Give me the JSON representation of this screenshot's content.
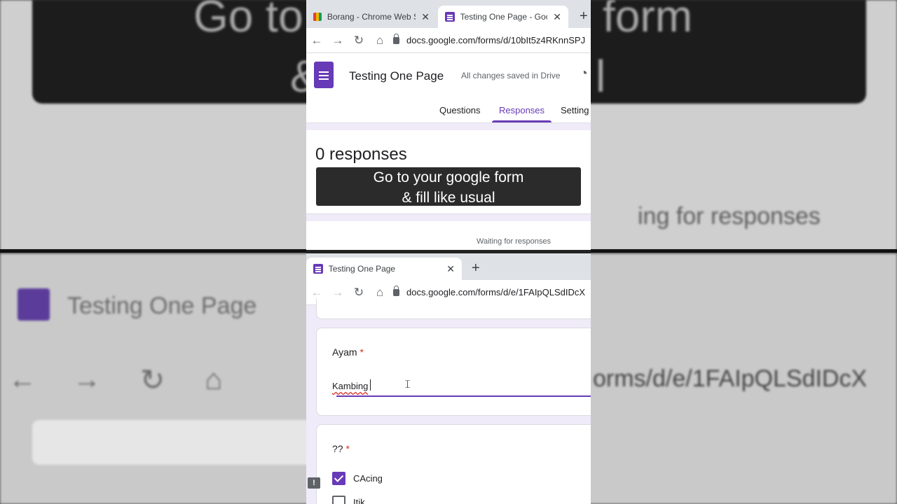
{
  "background": {
    "top_left_text": "Go to",
    "top_right_text": "form",
    "top_left2": "&",
    "top_right2": "l",
    "right_waiting": "ing for responses",
    "left_title": "Testing One Page",
    "right_url": "orms/d/e/1FAIpQLSdIDcX"
  },
  "top_window": {
    "tabs": [
      {
        "label": "Borang - Chrome Web Sto",
        "close": "✕"
      },
      {
        "label": "Testing One Page - Googl",
        "close": "✕"
      }
    ],
    "new_tab": "+",
    "url": "docs.google.com/forms/d/10bIt5z4RKnnSPJ",
    "form_title": "Testing One Page",
    "save_status": "All changes saved in Drive",
    "nav_tabs": [
      "Questions",
      "Responses",
      "Setting"
    ],
    "responses_count": "0 responses",
    "waiting": "Waiting for responses"
  },
  "caption": {
    "line1": "Go to your google form",
    "line2": "& fill like usual"
  },
  "bottom_window": {
    "tab_label": "Testing One Page",
    "tab_close": "✕",
    "new_tab": "+",
    "url": "docs.google.com/forms/d/e/1FAIpQLSdIDcX",
    "q1_title": "Ayam",
    "required": "*",
    "q1_answer": "Kambing",
    "q2_title": "??",
    "options": [
      "CAcing",
      "Itik"
    ]
  },
  "colors": {
    "accent": "#673ab7",
    "required": "#d93025"
  }
}
